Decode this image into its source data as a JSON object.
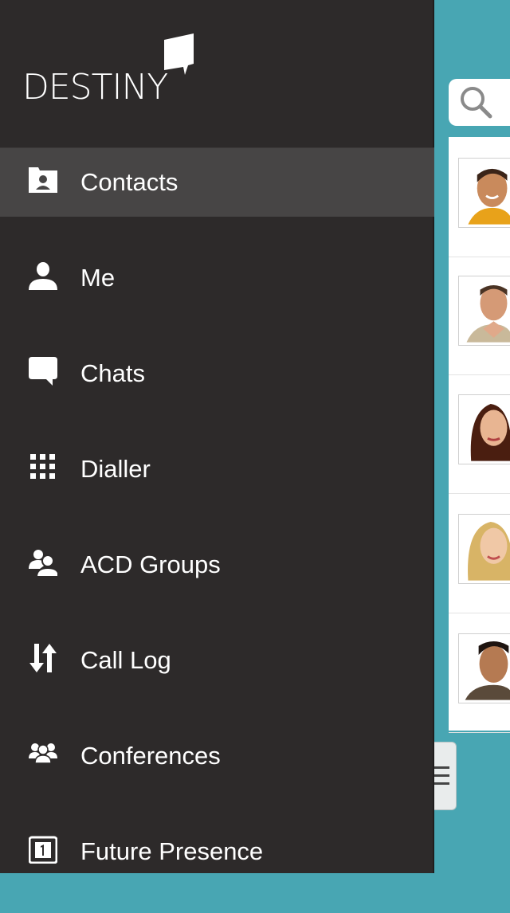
{
  "brand": {
    "logo_text": "DESTINY"
  },
  "menu": {
    "items": [
      {
        "label": "Contacts",
        "icon": "contacts-icon",
        "active": true
      },
      {
        "label": "Me",
        "icon": "person-icon",
        "active": false
      },
      {
        "label": "Chats",
        "icon": "chat-bubble-icon",
        "active": false
      },
      {
        "label": "Dialler",
        "icon": "keypad-icon",
        "active": false
      },
      {
        "label": "ACD Groups",
        "icon": "group-icon",
        "active": false
      },
      {
        "label": "Call Log",
        "icon": "up-down-arrows-icon",
        "active": false
      },
      {
        "label": "Conferences",
        "icon": "conference-icon",
        "active": false
      },
      {
        "label": "Future Presence",
        "icon": "calendar-icon",
        "active": false
      }
    ]
  },
  "colors": {
    "drawer_bg": "#2d2a2a",
    "active_item_bg": "#474545",
    "content_bg": "#48a6b3"
  }
}
